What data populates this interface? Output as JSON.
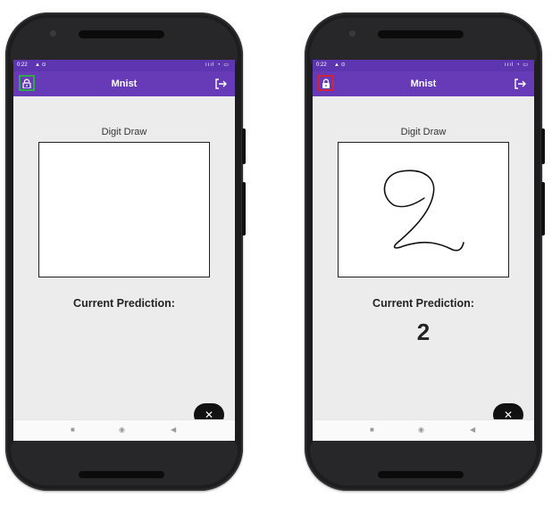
{
  "phones": [
    {
      "status_time": "0:22",
      "status_icons": "signal-wifi-battery",
      "app_title": "Mnist",
      "lock_icon": "lock-open-icon",
      "lock_highlight_color": "#2fa84f",
      "logout_icon": "logout-icon",
      "digit_draw_label": "Digit Draw",
      "canvas_content": "empty",
      "prediction_label": "Current Prediction:",
      "prediction_value": "",
      "fab_icon": "close-icon"
    },
    {
      "status_time": "0:22",
      "status_icons": "signal-wifi-battery",
      "app_title": "Mnist",
      "lock_icon": "lock-closed-icon",
      "lock_highlight_color": "#d0243a",
      "logout_icon": "logout-icon",
      "digit_draw_label": "Digit Draw",
      "canvas_content": "handwritten-digit-2",
      "prediction_label": "Current Prediction:",
      "prediction_value": "2",
      "fab_icon": "close-icon"
    }
  ],
  "colors": {
    "status_bar": "#5e35b1",
    "app_bar": "#673ab7",
    "screen_bg": "#ececec"
  }
}
